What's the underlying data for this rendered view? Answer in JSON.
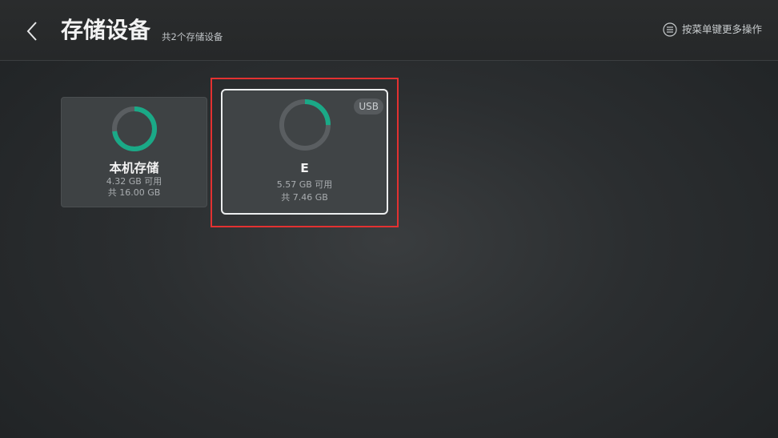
{
  "header": {
    "title": "存储设备",
    "subtitle": "共2个存储设备",
    "menu_hint": "按菜单键更多操作",
    "back_icon": "chevron-left-icon",
    "menu_icon": "menu-circle-icon"
  },
  "devices": [
    {
      "name": "本机存储",
      "available": "4.32 GB 可用",
      "total": "共 16.00 GB",
      "used_fraction": 0.73,
      "focused": false
    },
    {
      "name": "E",
      "badge": "USB",
      "available": "5.57 GB 可用",
      "total": "共 7.46 GB",
      "used_fraction": 0.25,
      "focused": true
    }
  ],
  "colors": {
    "ring_used": "#1aa987",
    "ring_track": "#5a5e61",
    "focus_highlight": "#e33131"
  }
}
